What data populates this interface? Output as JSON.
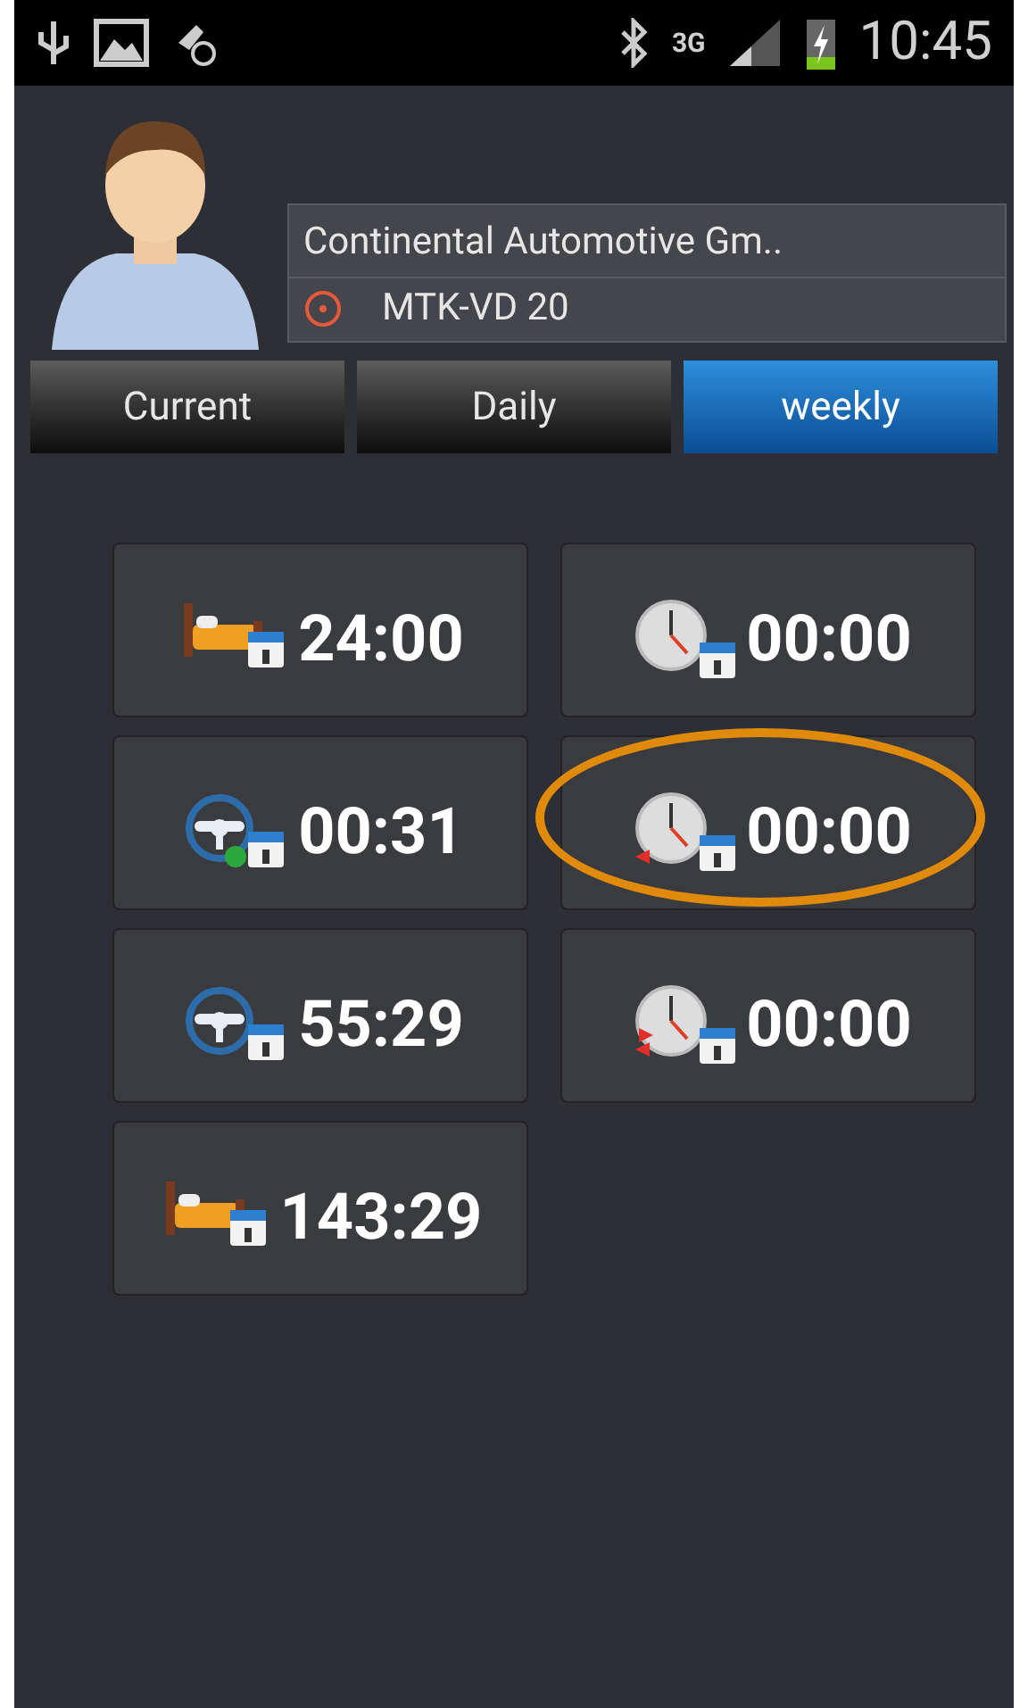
{
  "status_bar": {
    "time": "10:45",
    "network": "3G"
  },
  "device": {
    "company": "Continental Automotive Gm..",
    "model": "MTK-VD 20"
  },
  "tabs": [
    {
      "label": "Current",
      "selected": false
    },
    {
      "label": "Daily",
      "selected": false
    },
    {
      "label": "weekly",
      "selected": true
    }
  ],
  "tiles": [
    {
      "kind": "bed-day",
      "value": "24:00",
      "highlighted": false
    },
    {
      "kind": "clock",
      "value": "00:00",
      "highlighted": false
    },
    {
      "kind": "wheel-plus",
      "value": "00:31",
      "highlighted": false
    },
    {
      "kind": "clock-in",
      "value": "00:00",
      "highlighted": true
    },
    {
      "kind": "wheel",
      "value": "55:29",
      "highlighted": false
    },
    {
      "kind": "clock-swap",
      "value": "00:00",
      "highlighted": false
    },
    {
      "kind": "bed-week",
      "value": "143:29",
      "highlighted": false
    }
  ]
}
